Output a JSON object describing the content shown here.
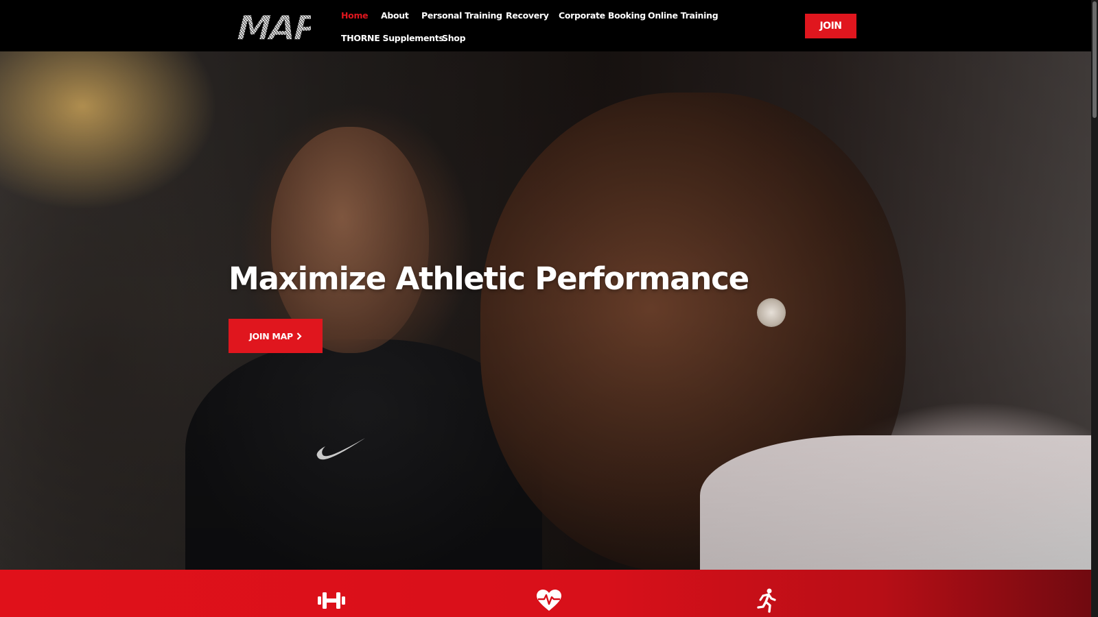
{
  "header": {
    "logo_text": "MAP",
    "nav": [
      {
        "label": "Home",
        "active": true
      },
      {
        "label": "About",
        "active": false
      },
      {
        "label": "Personal Training",
        "active": false
      },
      {
        "label": "Recovery",
        "active": false
      },
      {
        "label": "Corporate Booking",
        "active": false
      },
      {
        "label": "Online Training",
        "active": false
      },
      {
        "label": "THORNE Supplements",
        "active": false
      },
      {
        "label": "Shop",
        "active": false
      }
    ],
    "join_label": "JOIN"
  },
  "hero": {
    "title": "Maximize Athletic Performance",
    "cta_label": "JOIN MAP",
    "cta_icon": "chevron-right-icon"
  },
  "features": {
    "icons": [
      "dumbbell-icon",
      "heartbeat-icon",
      "running-icon"
    ]
  },
  "colors": {
    "accent": "#e0161e",
    "header_bg": "#000000",
    "text": "#ffffff"
  }
}
